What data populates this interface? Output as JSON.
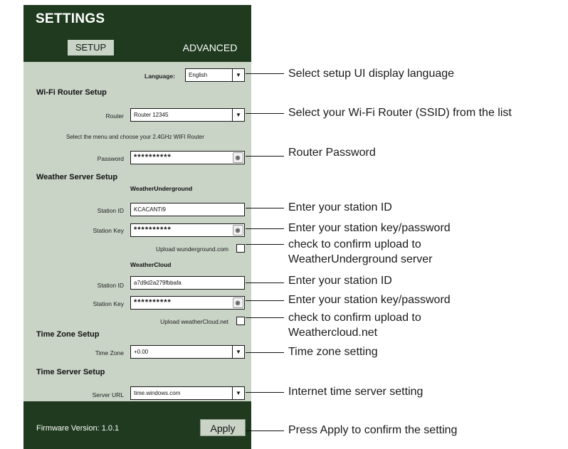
{
  "header": {
    "title": "SETTINGS",
    "tabs": [
      "SETUP",
      "ADVANCED"
    ]
  },
  "language": {
    "label": "Language:",
    "value": "English"
  },
  "wifi": {
    "section": "Wi-Fi Router Setup",
    "router_label": "Router",
    "router_value": "Router 12345",
    "help": "Select the menu and choose your 2.4GHz WIFI Router",
    "password_label": "Password",
    "password_value": "**********"
  },
  "weather": {
    "section": "Weather Server Setup",
    "wu": {
      "title": "WeatherUnderground",
      "id_label": "Station ID",
      "id_value": "KCACANTI9",
      "key_label": "Station Key",
      "key_value": "**********",
      "upload_label": "Upload wunderground.com"
    },
    "wc": {
      "title": "WeatherCloud",
      "id_label": "Station ID",
      "id_value": "a7d9d2a279fbbafa",
      "key_label": "Station Key",
      "key_value": "**********",
      "upload_label": "Upload weatherCloud.net"
    }
  },
  "timezone": {
    "section": "Time Zone Setup",
    "label": "Time Zone",
    "value": "+0.00"
  },
  "timeserver": {
    "section": "Time Server Setup",
    "label": "Server URL",
    "value": "time.windows.com"
  },
  "footer": {
    "firmware": "Firmware Version: 1.0.1",
    "apply": "Apply"
  },
  "annotations": [
    "Select setup UI display language",
    "Select your Wi-Fi Router (SSID) from the list",
    "Router Password",
    "Enter your station ID",
    "Enter your station key/password",
    "check to confirm upload to",
    "WeatherUnderground server",
    "Enter your station ID",
    "Enter your station key/password",
    "check to confirm upload to",
    "Weathercloud.net",
    "Time zone setting",
    "Internet time server setting",
    "Press Apply to confirm the setting"
  ]
}
